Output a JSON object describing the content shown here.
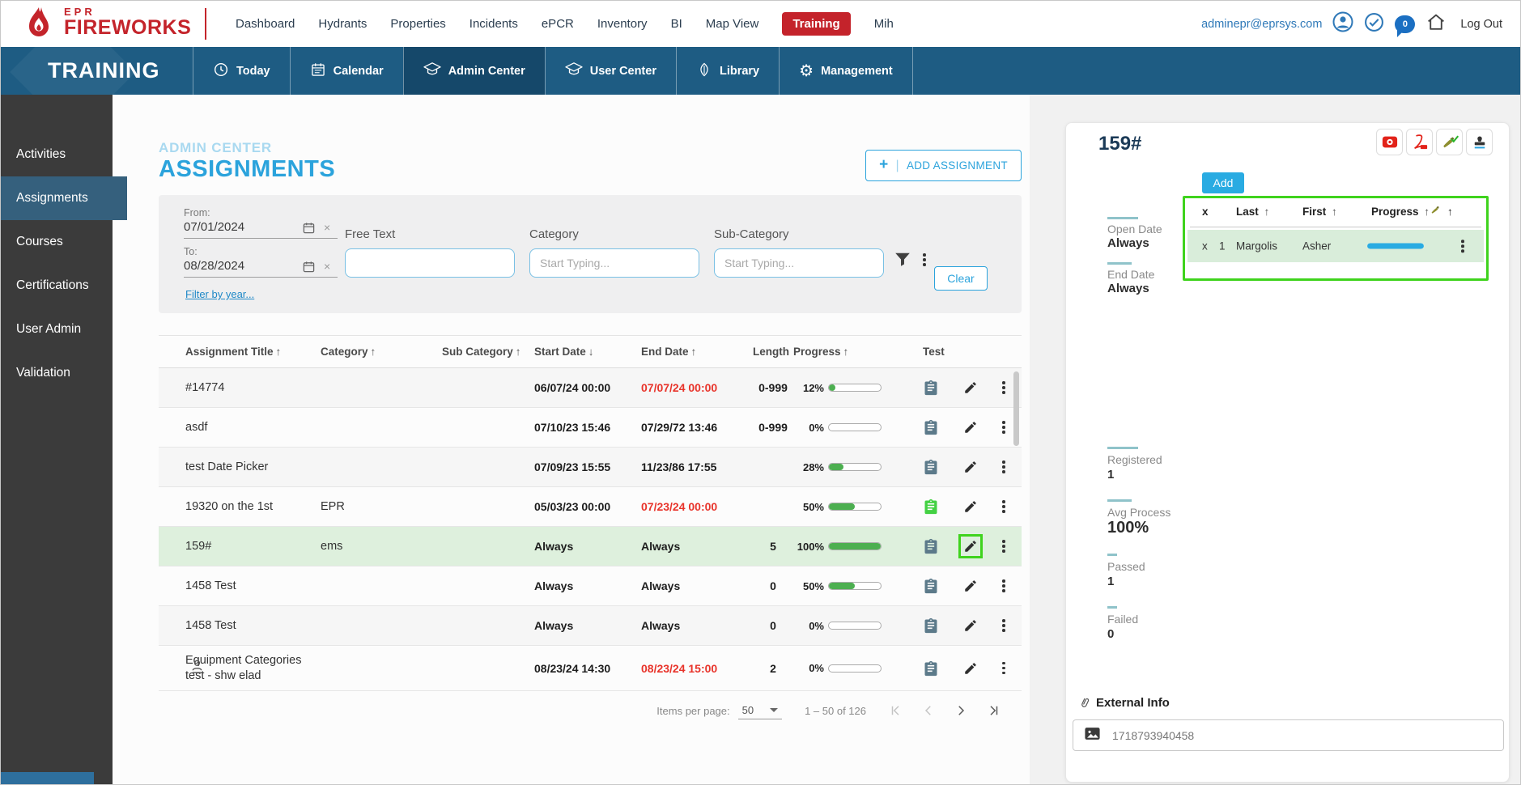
{
  "theme": {
    "accent_blue": "#2ba3dc",
    "brand_red": "#c4242b",
    "bar_blue": "#1e5c83",
    "progress_green": "#4caf50",
    "annotation_green": "#3fd31d",
    "expired_red": "#e8332a"
  },
  "topbar": {
    "logo_line1": "EPR",
    "logo_line2": "FIREWORKS",
    "nav": [
      {
        "label": "Dashboard"
      },
      {
        "label": "Hydrants"
      },
      {
        "label": "Properties"
      },
      {
        "label": "Incidents"
      },
      {
        "label": "ePCR"
      },
      {
        "label": "Inventory"
      },
      {
        "label": "BI"
      },
      {
        "label": "Map View"
      },
      {
        "label": "Training",
        "active": true
      },
      {
        "label": "Mih"
      }
    ],
    "email": "adminepr@eprsys.com",
    "badge_count": "0",
    "logout_label": "Log Out"
  },
  "modulebar": {
    "title": "TRAINING",
    "tabs": [
      {
        "label": "Today"
      },
      {
        "label": "Calendar"
      },
      {
        "label": "Admin Center",
        "active": true
      },
      {
        "label": "User Center"
      },
      {
        "label": "Library"
      },
      {
        "label": "Management"
      }
    ]
  },
  "sidebar": {
    "items": [
      {
        "label": "Activities"
      },
      {
        "label": "Assignments",
        "active": true
      },
      {
        "label": "Courses"
      },
      {
        "label": "Certifications"
      },
      {
        "label": "User Admin"
      },
      {
        "label": "Validation"
      }
    ]
  },
  "page": {
    "breadcrumb": "ADMIN CENTER",
    "title": "ASSIGNMENTS",
    "add_button_label": "ADD ASSIGNMENT"
  },
  "filters": {
    "from_label": "From:",
    "from_value": "07/01/2024",
    "to_label": "To:",
    "to_value": "08/28/2024",
    "filter_by_year_label": "Filter by year...",
    "free_text_label": "Free Text",
    "category_label": "Category",
    "category_placeholder": "Start Typing...",
    "subcategory_label": "Sub-Category",
    "subcategory_placeholder": "Start Typing...",
    "clear_button_label": "Clear"
  },
  "table": {
    "columns": [
      {
        "label": "Assignment Title",
        "arrow": "↑"
      },
      {
        "label": "Category",
        "arrow": "↑"
      },
      {
        "label": "Sub Category",
        "arrow": "↑"
      },
      {
        "label": "Start Date",
        "arrow": "↓"
      },
      {
        "label": "End Date",
        "arrow": "↑"
      },
      {
        "label": "Length",
        "arrow": ""
      },
      {
        "label": "Progress",
        "arrow": "↑"
      },
      {
        "label": "Test",
        "arrow": ""
      }
    ],
    "rows": [
      {
        "title": "#14774",
        "title2": "",
        "user_icon": false,
        "category": "",
        "subcategory": "",
        "start": "06/07/24 00:00",
        "end": "07/07/24 00:00",
        "end_expired": true,
        "length": "0-999",
        "progress_label": "12%",
        "progress_pct": 12,
        "test_passed": false,
        "highlighted": false,
        "edit_annotated": false
      },
      {
        "title": "asdf",
        "title2": "",
        "user_icon": false,
        "category": "",
        "subcategory": "",
        "start": "07/10/23 15:46",
        "end": "07/29/72 13:46",
        "end_expired": false,
        "length": "0-999",
        "progress_label": "0%",
        "progress_pct": 0,
        "test_passed": false,
        "highlighted": false,
        "edit_annotated": false
      },
      {
        "title": "test Date Picker",
        "title2": "",
        "user_icon": false,
        "category": "",
        "subcategory": "",
        "start": "07/09/23 15:55",
        "end": "11/23/86 17:55",
        "end_expired": false,
        "length": "",
        "progress_label": "28%",
        "progress_pct": 28,
        "test_passed": false,
        "highlighted": false,
        "edit_annotated": false
      },
      {
        "title": "19320 on the 1st",
        "title2": "",
        "user_icon": false,
        "category": "EPR",
        "subcategory": "",
        "start": "05/03/23 00:00",
        "end": "07/23/24 00:00",
        "end_expired": true,
        "length": "",
        "progress_label": "50%",
        "progress_pct": 50,
        "test_passed": true,
        "highlighted": false,
        "edit_annotated": false
      },
      {
        "title": "159#",
        "title2": "",
        "user_icon": false,
        "category": "ems",
        "subcategory": "",
        "start": "Always",
        "end": "Always",
        "end_expired": false,
        "length": "5",
        "progress_label": "100%",
        "progress_pct": 100,
        "test_passed": false,
        "highlighted": true,
        "edit_annotated": true
      },
      {
        "title": "1458 Test",
        "title2": "",
        "user_icon": false,
        "category": "",
        "subcategory": "",
        "start": "Always",
        "end": "Always",
        "end_expired": false,
        "length": "0",
        "progress_label": "50%",
        "progress_pct": 50,
        "test_passed": false,
        "highlighted": false,
        "edit_annotated": false
      },
      {
        "title": "1458 Test",
        "title2": "",
        "user_icon": false,
        "category": "",
        "subcategory": "",
        "start": "Always",
        "end": "Always",
        "end_expired": false,
        "length": "0",
        "progress_label": "0%",
        "progress_pct": 0,
        "test_passed": false,
        "highlighted": false,
        "edit_annotated": false
      },
      {
        "title": "Equipment Categories",
        "title2": "test - shw elad",
        "user_icon": true,
        "category": "",
        "subcategory": "",
        "start": "08/23/24 14:30",
        "end": "08/23/24 15:00",
        "end_expired": true,
        "length": "2",
        "progress_label": "0%",
        "progress_pct": 0,
        "test_passed": false,
        "highlighted": false,
        "edit_annotated": false
      }
    ],
    "pagination": {
      "items_per_page_label": "Items per page:",
      "items_per_page_value": "50",
      "range_label": "1 – 50 of 126"
    }
  },
  "detail": {
    "title": "159#",
    "add_button_label": "Add",
    "participants": {
      "columns": [
        {
          "label": "x",
          "arrow": ""
        },
        {
          "label": "Last",
          "arrow": "↑"
        },
        {
          "label": "First",
          "arrow": "↑"
        },
        {
          "label": "Progress",
          "arrow": "↑"
        }
      ],
      "extra_sort_arrow": "↑",
      "rows": [
        {
          "remove": "x",
          "index": "1",
          "last": "Margolis",
          "first": "Asher",
          "progress_pct": 100
        }
      ]
    },
    "open_date_label": "Open Date",
    "open_date_value": "Always",
    "end_date_label": "End Date",
    "end_date_value": "Always",
    "stats": [
      {
        "label": "Registered",
        "value": "1"
      },
      {
        "label": "Avg Process",
        "value": "100%"
      },
      {
        "label": "Passed",
        "value": "1"
      },
      {
        "label": "Failed",
        "value": "0"
      }
    ],
    "external_info_label": "External Info",
    "external_info_value": "1718793940458"
  }
}
